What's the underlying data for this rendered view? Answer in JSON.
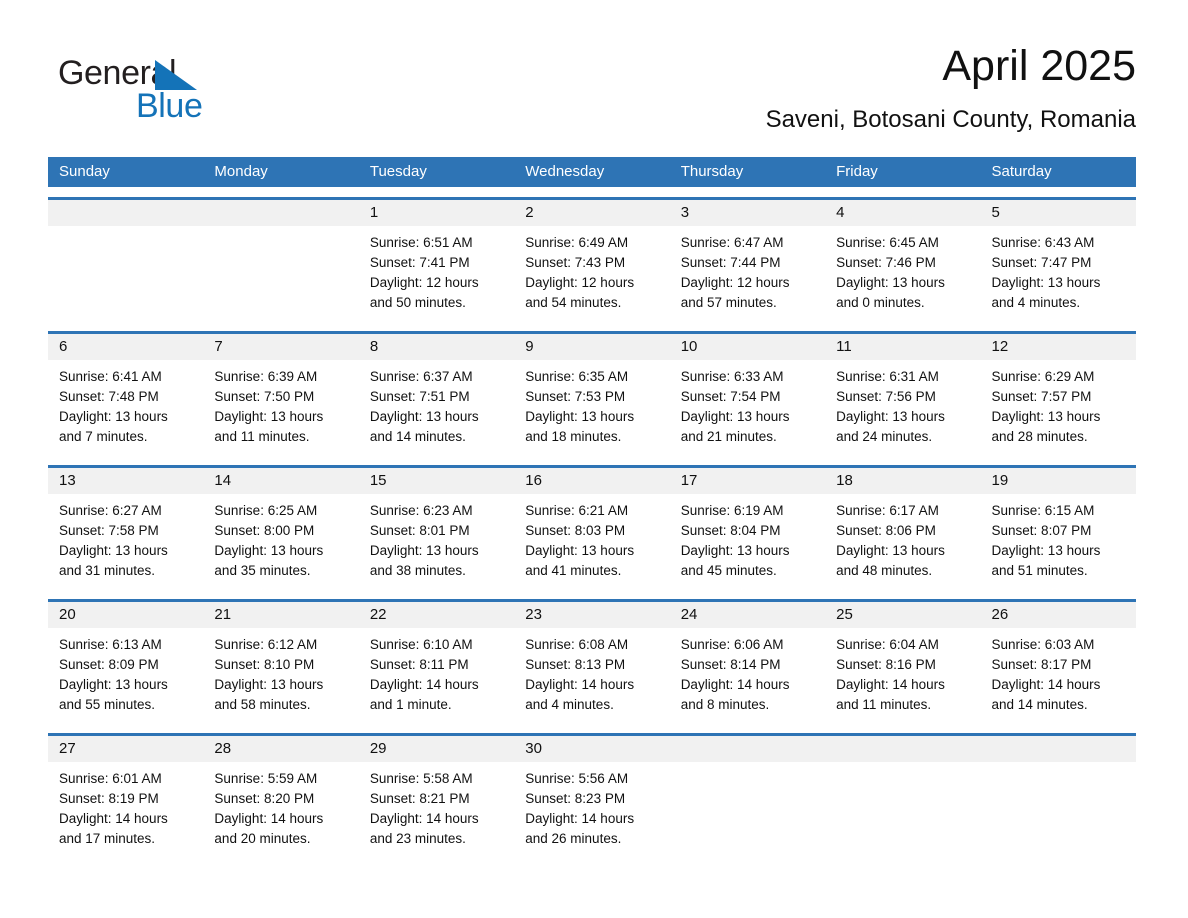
{
  "brand": {
    "name_part1": "General",
    "name_part2": "Blue",
    "accent_color": "#1473b8",
    "triangle_icon": "triangle-icon"
  },
  "header": {
    "title": "April 2025",
    "subtitle": "Saveni, Botosani County, Romania"
  },
  "calendar": {
    "header_color": "#2e74b5",
    "date_band_color": "#f1f1f1",
    "weekdays": [
      "Sunday",
      "Monday",
      "Tuesday",
      "Wednesday",
      "Thursday",
      "Friday",
      "Saturday"
    ],
    "weeks": [
      {
        "days": [
          {
            "num": "",
            "sunrise": "",
            "sunset": "",
            "daylight": ""
          },
          {
            "num": "",
            "sunrise": "",
            "sunset": "",
            "daylight": ""
          },
          {
            "num": "1",
            "sunrise": "Sunrise: 6:51 AM",
            "sunset": "Sunset: 7:41 PM",
            "daylight": "Daylight: 12 hours and 50 minutes."
          },
          {
            "num": "2",
            "sunrise": "Sunrise: 6:49 AM",
            "sunset": "Sunset: 7:43 PM",
            "daylight": "Daylight: 12 hours and 54 minutes."
          },
          {
            "num": "3",
            "sunrise": "Sunrise: 6:47 AM",
            "sunset": "Sunset: 7:44 PM",
            "daylight": "Daylight: 12 hours and 57 minutes."
          },
          {
            "num": "4",
            "sunrise": "Sunrise: 6:45 AM",
            "sunset": "Sunset: 7:46 PM",
            "daylight": "Daylight: 13 hours and 0 minutes."
          },
          {
            "num": "5",
            "sunrise": "Sunrise: 6:43 AM",
            "sunset": "Sunset: 7:47 PM",
            "daylight": "Daylight: 13 hours and 4 minutes."
          }
        ]
      },
      {
        "days": [
          {
            "num": "6",
            "sunrise": "Sunrise: 6:41 AM",
            "sunset": "Sunset: 7:48 PM",
            "daylight": "Daylight: 13 hours and 7 minutes."
          },
          {
            "num": "7",
            "sunrise": "Sunrise: 6:39 AM",
            "sunset": "Sunset: 7:50 PM",
            "daylight": "Daylight: 13 hours and 11 minutes."
          },
          {
            "num": "8",
            "sunrise": "Sunrise: 6:37 AM",
            "sunset": "Sunset: 7:51 PM",
            "daylight": "Daylight: 13 hours and 14 minutes."
          },
          {
            "num": "9",
            "sunrise": "Sunrise: 6:35 AM",
            "sunset": "Sunset: 7:53 PM",
            "daylight": "Daylight: 13 hours and 18 minutes."
          },
          {
            "num": "10",
            "sunrise": "Sunrise: 6:33 AM",
            "sunset": "Sunset: 7:54 PM",
            "daylight": "Daylight: 13 hours and 21 minutes."
          },
          {
            "num": "11",
            "sunrise": "Sunrise: 6:31 AM",
            "sunset": "Sunset: 7:56 PM",
            "daylight": "Daylight: 13 hours and 24 minutes."
          },
          {
            "num": "12",
            "sunrise": "Sunrise: 6:29 AM",
            "sunset": "Sunset: 7:57 PM",
            "daylight": "Daylight: 13 hours and 28 minutes."
          }
        ]
      },
      {
        "days": [
          {
            "num": "13",
            "sunrise": "Sunrise: 6:27 AM",
            "sunset": "Sunset: 7:58 PM",
            "daylight": "Daylight: 13 hours and 31 minutes."
          },
          {
            "num": "14",
            "sunrise": "Sunrise: 6:25 AM",
            "sunset": "Sunset: 8:00 PM",
            "daylight": "Daylight: 13 hours and 35 minutes."
          },
          {
            "num": "15",
            "sunrise": "Sunrise: 6:23 AM",
            "sunset": "Sunset: 8:01 PM",
            "daylight": "Daylight: 13 hours and 38 minutes."
          },
          {
            "num": "16",
            "sunrise": "Sunrise: 6:21 AM",
            "sunset": "Sunset: 8:03 PM",
            "daylight": "Daylight: 13 hours and 41 minutes."
          },
          {
            "num": "17",
            "sunrise": "Sunrise: 6:19 AM",
            "sunset": "Sunset: 8:04 PM",
            "daylight": "Daylight: 13 hours and 45 minutes."
          },
          {
            "num": "18",
            "sunrise": "Sunrise: 6:17 AM",
            "sunset": "Sunset: 8:06 PM",
            "daylight": "Daylight: 13 hours and 48 minutes."
          },
          {
            "num": "19",
            "sunrise": "Sunrise: 6:15 AM",
            "sunset": "Sunset: 8:07 PM",
            "daylight": "Daylight: 13 hours and 51 minutes."
          }
        ]
      },
      {
        "days": [
          {
            "num": "20",
            "sunrise": "Sunrise: 6:13 AM",
            "sunset": "Sunset: 8:09 PM",
            "daylight": "Daylight: 13 hours and 55 minutes."
          },
          {
            "num": "21",
            "sunrise": "Sunrise: 6:12 AM",
            "sunset": "Sunset: 8:10 PM",
            "daylight": "Daylight: 13 hours and 58 minutes."
          },
          {
            "num": "22",
            "sunrise": "Sunrise: 6:10 AM",
            "sunset": "Sunset: 8:11 PM",
            "daylight": "Daylight: 14 hours and 1 minute."
          },
          {
            "num": "23",
            "sunrise": "Sunrise: 6:08 AM",
            "sunset": "Sunset: 8:13 PM",
            "daylight": "Daylight: 14 hours and 4 minutes."
          },
          {
            "num": "24",
            "sunrise": "Sunrise: 6:06 AM",
            "sunset": "Sunset: 8:14 PM",
            "daylight": "Daylight: 14 hours and 8 minutes."
          },
          {
            "num": "25",
            "sunrise": "Sunrise: 6:04 AM",
            "sunset": "Sunset: 8:16 PM",
            "daylight": "Daylight: 14 hours and 11 minutes."
          },
          {
            "num": "26",
            "sunrise": "Sunrise: 6:03 AM",
            "sunset": "Sunset: 8:17 PM",
            "daylight": "Daylight: 14 hours and 14 minutes."
          }
        ]
      },
      {
        "days": [
          {
            "num": "27",
            "sunrise": "Sunrise: 6:01 AM",
            "sunset": "Sunset: 8:19 PM",
            "daylight": "Daylight: 14 hours and 17 minutes."
          },
          {
            "num": "28",
            "sunrise": "Sunrise: 5:59 AM",
            "sunset": "Sunset: 8:20 PM",
            "daylight": "Daylight: 14 hours and 20 minutes."
          },
          {
            "num": "29",
            "sunrise": "Sunrise: 5:58 AM",
            "sunset": "Sunset: 8:21 PM",
            "daylight": "Daylight: 14 hours and 23 minutes."
          },
          {
            "num": "30",
            "sunrise": "Sunrise: 5:56 AM",
            "sunset": "Sunset: 8:23 PM",
            "daylight": "Daylight: 14 hours and 26 minutes."
          },
          {
            "num": "",
            "sunrise": "",
            "sunset": "",
            "daylight": ""
          },
          {
            "num": "",
            "sunrise": "",
            "sunset": "",
            "daylight": ""
          },
          {
            "num": "",
            "sunrise": "",
            "sunset": "",
            "daylight": ""
          }
        ]
      }
    ]
  }
}
